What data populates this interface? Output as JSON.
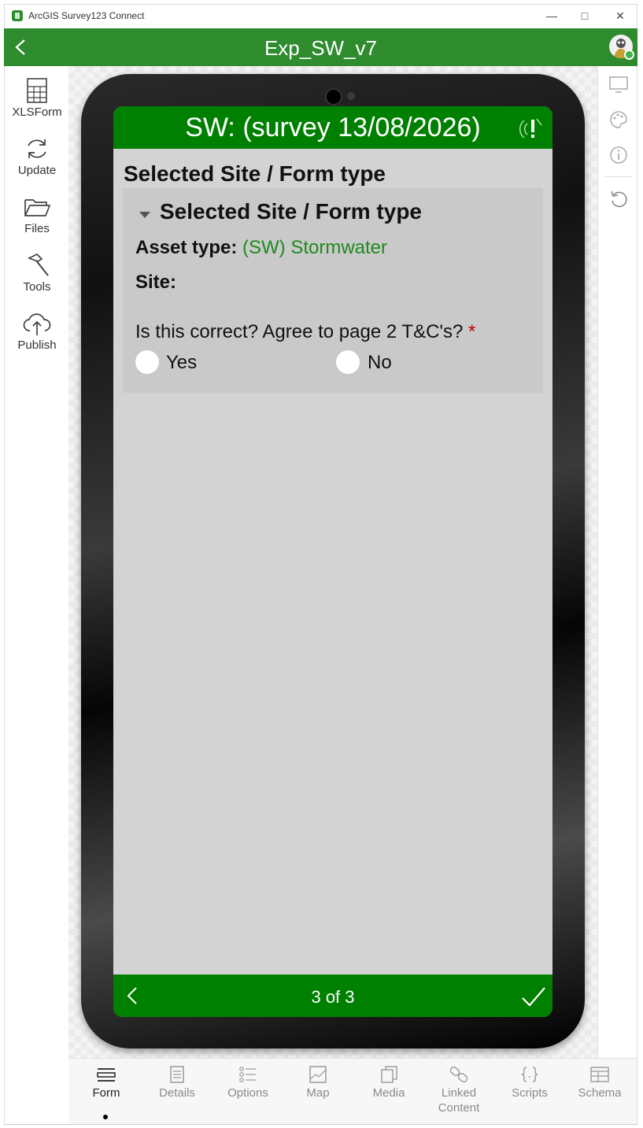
{
  "window": {
    "title": "ArcGIS Survey123 Connect"
  },
  "header": {
    "title": "Exp_SW_v7"
  },
  "left_toolbar": [
    {
      "key": "xlsform",
      "label": "XLSForm"
    },
    {
      "key": "update",
      "label": "Update"
    },
    {
      "key": "files",
      "label": "Files"
    },
    {
      "key": "tools",
      "label": "Tools"
    },
    {
      "key": "publish",
      "label": "Publish"
    }
  ],
  "survey": {
    "title": "SW:  (survey 13/08/2026)",
    "page_heading": "Selected Site / Form type",
    "group": {
      "title": "Selected Site / Form type",
      "asset_type_label": "Asset type:",
      "asset_type_value": "(SW) Stormwater",
      "site_label": "Site:",
      "question": "Is this correct? Agree to page 2 T&C's?",
      "required_marker": "*",
      "options": [
        "Yes",
        "No"
      ]
    },
    "page_indicator": "3 of 3"
  },
  "tabs": [
    {
      "key": "form",
      "label": "Form",
      "active": true
    },
    {
      "key": "details",
      "label": "Details"
    },
    {
      "key": "options",
      "label": "Options"
    },
    {
      "key": "map",
      "label": "Map"
    },
    {
      "key": "media",
      "label": "Media"
    },
    {
      "key": "linked",
      "label": "Linked\nContent"
    },
    {
      "key": "scripts",
      "label": "Scripts"
    },
    {
      "key": "schema",
      "label": "Schema"
    }
  ],
  "colors": {
    "app_green": "#2e8b2e",
    "survey_green": "#008000",
    "value_green": "#1e8a1e",
    "required_red": "#c00000"
  }
}
